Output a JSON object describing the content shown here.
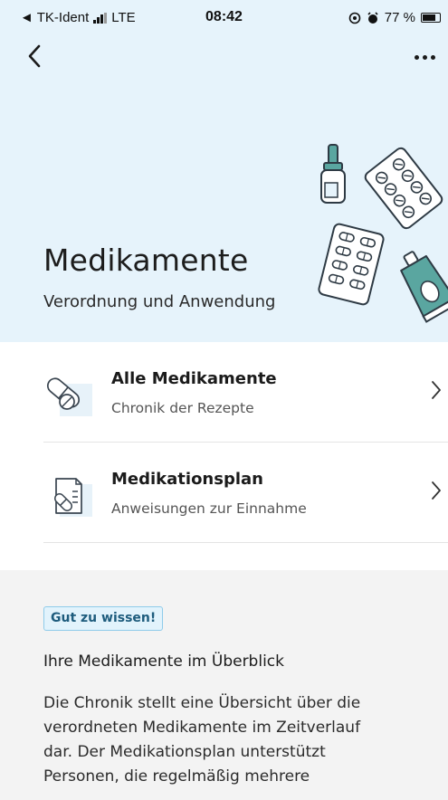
{
  "status_bar": {
    "carrier": "◄ TK-Ident",
    "network": "LTE",
    "time": "08:42",
    "battery_percent": "77 %",
    "battery_level": 0.77
  },
  "nav": {
    "back_icon": "chevron-left",
    "more_icon": "ellipsis-horizontal"
  },
  "header": {
    "title": "Medikamente",
    "subtitle": "Verordnung und Anwendung"
  },
  "menu": {
    "items": [
      {
        "title": "Alle Medikamente",
        "subtitle": "Chronik der Rezepte",
        "icon": "pill-icon"
      },
      {
        "title": "Medikationsplan",
        "subtitle": "Anweisungen zur Einnahme",
        "icon": "medication-plan-icon"
      }
    ]
  },
  "info": {
    "badge": "Gut zu wissen!",
    "heading": "Ihre Medikamente im Überblick",
    "lines": [
      "Die Chronik stellt eine Übersicht über die",
      "verordneten Medikamente im Zeitverlauf",
      "dar. Der Medikationsplan unterstützt",
      "Personen, die regelmäßig mehrere"
    ]
  },
  "colors": {
    "hero_background": "#e6f3fb",
    "info_background": "#f3f3f3",
    "badge_border": "#8ecbea",
    "illustration_teal": "#5aa6a0"
  }
}
